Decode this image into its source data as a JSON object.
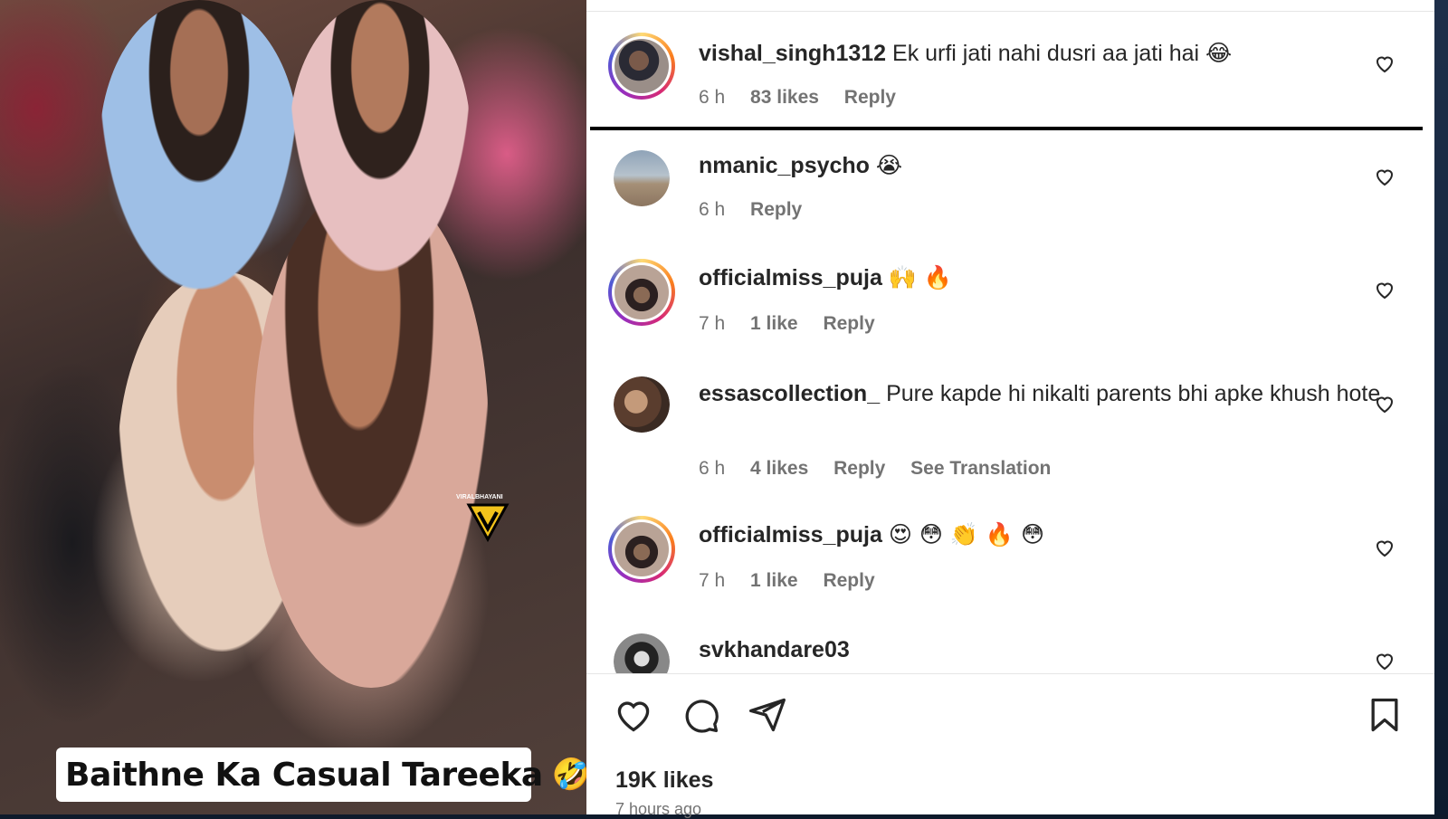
{
  "media": {
    "caption_text": "Baithne Ka Casual Tareeka",
    "caption_emoji": "🤣",
    "watermark_text": "VIRALBHAYANI",
    "background_color": "#3b2e2c"
  },
  "comments": [
    {
      "username": "vishal_singh1312",
      "text": "Ek urfi jati nahi dusri aa jati hai",
      "emojis": "😂",
      "time": "6 h",
      "likes": "83 likes",
      "reply": "Reply",
      "avatar_ring": true
    },
    {
      "username": "nmanic_psycho",
      "text": "",
      "emojis": "😭",
      "time": "6 h",
      "likes": "",
      "reply": "Reply",
      "avatar_ring": false
    },
    {
      "username": "officialmiss_puja",
      "text": "",
      "emojis": "🙌 🔥",
      "time": "7 h",
      "likes": "1 like",
      "reply": "Reply",
      "avatar_ring": true
    },
    {
      "username": "essascollection_",
      "text": "Pure kapde hi nikalti parents bhi apke khush hote",
      "emojis": "",
      "time": "6 h",
      "likes": "4 likes",
      "reply": "Reply",
      "translation": "See Translation",
      "avatar_ring": false
    },
    {
      "username": "officialmiss_puja",
      "text": "",
      "emojis": "😍 😳 👏 🔥 😳",
      "time": "7 h",
      "likes": "1 like",
      "reply": "Reply",
      "avatar_ring": true
    },
    {
      "username": "svkhandare03",
      "text": "",
      "emojis": "",
      "avatar_ring": false
    }
  ],
  "actions": {
    "like_icon": "heart-outline-icon",
    "comment_icon": "comment-bubble-icon",
    "share_icon": "paper-plane-icon",
    "save_icon": "bookmark-icon"
  },
  "post": {
    "likes_count": "19K likes",
    "time_ago": "7 hours ago"
  },
  "colors": {
    "text_primary": "#262626",
    "text_secondary": "#737373",
    "story_ring": "#d62976"
  }
}
